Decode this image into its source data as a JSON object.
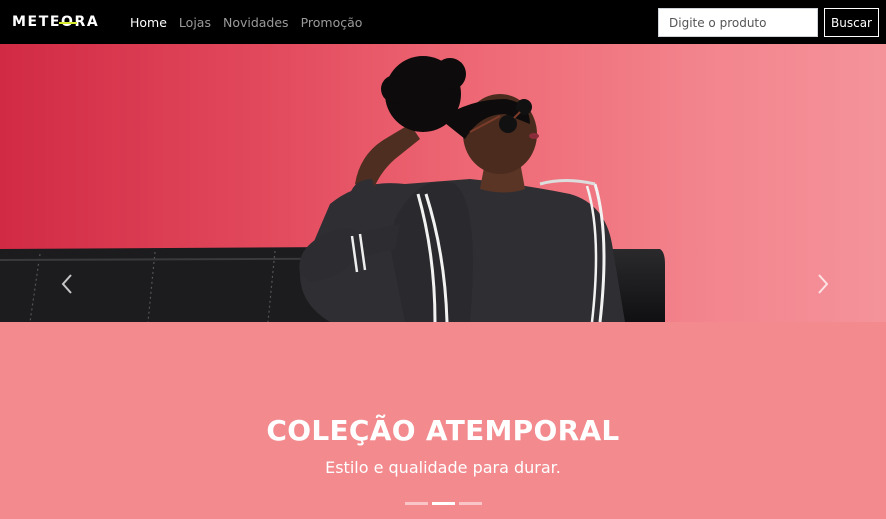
{
  "navbar": {
    "brand": "METEORA",
    "brand_accent": "#d7e92c",
    "links": [
      {
        "label": "Home",
        "active": true
      },
      {
        "label": "Lojas",
        "active": false
      },
      {
        "label": "Novidades",
        "active": false
      },
      {
        "label": "Promoção",
        "active": false
      }
    ],
    "search": {
      "placeholder": "Digite o produto",
      "value": "",
      "button_label": "Buscar"
    }
  },
  "carousel": {
    "prev_icon": "chevron-left-icon",
    "next_icon": "chevron-right-icon",
    "active_slide": 2,
    "slide_count": 3,
    "caption": {
      "title": "COLEÇÃO ATEMPORAL",
      "subtitle": "Estilo e qualidade para durar."
    },
    "background_color": "#f28a8e"
  }
}
